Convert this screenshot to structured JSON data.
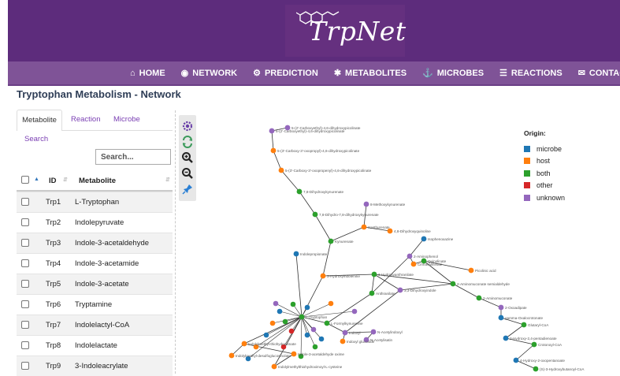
{
  "brand": {
    "logo_text": "TrpNet"
  },
  "nav": {
    "items": [
      {
        "label": "HOME",
        "icon": "home-icon"
      },
      {
        "label": "NETWORK",
        "icon": "eye-icon"
      },
      {
        "label": "PREDICTION",
        "icon": "gears-icon"
      },
      {
        "label": "METABOLITES",
        "icon": "asterisk-icon"
      },
      {
        "label": "MICROBES",
        "icon": "anchor-icon"
      },
      {
        "label": "REACTIONS",
        "icon": "database-icon"
      },
      {
        "label": "CONTACT",
        "icon": "envelope-icon"
      }
    ]
  },
  "page": {
    "title": "Tryptophan Metabolism - Network"
  },
  "tabs": {
    "metabolite": "Metabolite",
    "reaction": "Reaction",
    "microbe": "Microbe",
    "search": "Search"
  },
  "search": {
    "placeholder": "Search..."
  },
  "table": {
    "headers": {
      "id": "ID",
      "metabolite": "Metabolite"
    },
    "rows": [
      {
        "id": "Trp1",
        "name": "L-Tryptophan"
      },
      {
        "id": "Trp2",
        "name": "Indolepyruvate"
      },
      {
        "id": "Trp3",
        "name": "Indole-3-acetaldehyde"
      },
      {
        "id": "Trp4",
        "name": "Indole-3-acetamide"
      },
      {
        "id": "Trp5",
        "name": "Indole-3-acetate"
      },
      {
        "id": "Trp6",
        "name": "Tryptamine"
      },
      {
        "id": "Trp7",
        "name": "Indolelactyl-CoA"
      },
      {
        "id": "Trp8",
        "name": "Indolelactate"
      },
      {
        "id": "Trp9",
        "name": "3-Indoleacrylate"
      }
    ]
  },
  "toolbar": {
    "tools": [
      {
        "name": "settings-gear-icon"
      },
      {
        "name": "refresh-icon"
      },
      {
        "name": "zoom-in-icon"
      },
      {
        "name": "zoom-out-icon"
      },
      {
        "name": "pin-icon"
      }
    ]
  },
  "legend": {
    "title": "Origin:",
    "items": [
      {
        "label": "microbe",
        "color": "#1f77b4"
      },
      {
        "label": "host",
        "color": "#ff7f0e"
      },
      {
        "label": "both",
        "color": "#2ca02c"
      },
      {
        "label": "other",
        "color": "#d62728"
      },
      {
        "label": "unknown",
        "color": "#9467bd"
      }
    ]
  },
  "network": {
    "nodes": [
      {
        "label": "5-(2'-Carboxyethyl)-4,6-dihydroxypicolinate",
        "origin": "unknown"
      },
      {
        "label": "5-(2'-Carboxyethyl)-4,6-dihydroxypicolinate",
        "origin": "unknown"
      },
      {
        "label": "5-(3'-Carboxy-3'-oxopropyl)-4,6-dihydroxypicolinate",
        "origin": "host"
      },
      {
        "label": "5-(3'-Carboxy-3'-oxopropenyl)-4,6-dihydroxypicolinate",
        "origin": "host"
      },
      {
        "label": "7,8-Dihydroxykynurenate",
        "origin": "both"
      },
      {
        "label": "8-Methoxykynurenate",
        "origin": "unknown"
      },
      {
        "label": "7,8-Dihydro-7,8-dihydroxykynurenate",
        "origin": "both"
      },
      {
        "label": "Xanthurenate",
        "origin": "host"
      },
      {
        "label": "4,8-Dihydroxyquinoline",
        "origin": "host"
      },
      {
        "label": "Isophenoxazine",
        "origin": "microbe"
      },
      {
        "label": "Kynurenate",
        "origin": "both"
      },
      {
        "label": "Indolepropionate",
        "origin": "microbe"
      },
      {
        "label": "2-Aminophenol",
        "origin": "unknown"
      },
      {
        "label": "Cinnavalininate",
        "origin": "host"
      },
      {
        "label": "Quinolinate",
        "origin": "both"
      },
      {
        "label": "Picolinic acid",
        "origin": "host"
      },
      {
        "label": "3-Hydroxyindolenine",
        "origin": "host"
      },
      {
        "label": "3-Hydroxyanthranilate",
        "origin": "both"
      },
      {
        "label": "Anthranilate",
        "origin": "both"
      },
      {
        "label": "3,3-Dihydroxyindole",
        "origin": "unknown"
      },
      {
        "label": "2-Aminomuconate semialdehyde",
        "origin": "both"
      },
      {
        "label": "2-Aminomuconate",
        "origin": "both"
      },
      {
        "label": "2-Oxoadipate",
        "origin": "unknown"
      },
      {
        "label": "gamma-Oxalocrotonate",
        "origin": "microbe"
      },
      {
        "label": "Glutaryl-CoA",
        "origin": "both"
      },
      {
        "label": "2-Hydroxy-2,4-pentadienoate",
        "origin": "microbe"
      },
      {
        "label": "Crotonoyl-CoA",
        "origin": "both"
      },
      {
        "label": "4-Hydroxy-2-oxopentanoate",
        "origin": "microbe"
      },
      {
        "label": "(S)-3-Hydroxybutanoyl-CoA",
        "origin": "both"
      },
      {
        "label": "L-Formylkynurenine",
        "origin": "both"
      },
      {
        "label": "Indoxyl",
        "origin": "unknown"
      },
      {
        "label": "N-Acetylindoxyl",
        "origin": "unknown"
      },
      {
        "label": "N-Acetylisatin",
        "origin": "unknown"
      },
      {
        "label": "Indoxyl glucoside",
        "origin": "host"
      },
      {
        "label": "L-Tryptophan",
        "origin": "both"
      },
      {
        "label": "Indolylmethyl-desulfoglucosinolate",
        "origin": "host"
      },
      {
        "label": "Indolylmethyl-thiohydroximate",
        "origin": "host"
      },
      {
        "label": "Indole-3-acetaldehyde oxime",
        "origin": "host"
      },
      {
        "label": "Indolylmethylthiohydroximoyl-L-cysteine",
        "origin": "host"
      }
    ]
  }
}
